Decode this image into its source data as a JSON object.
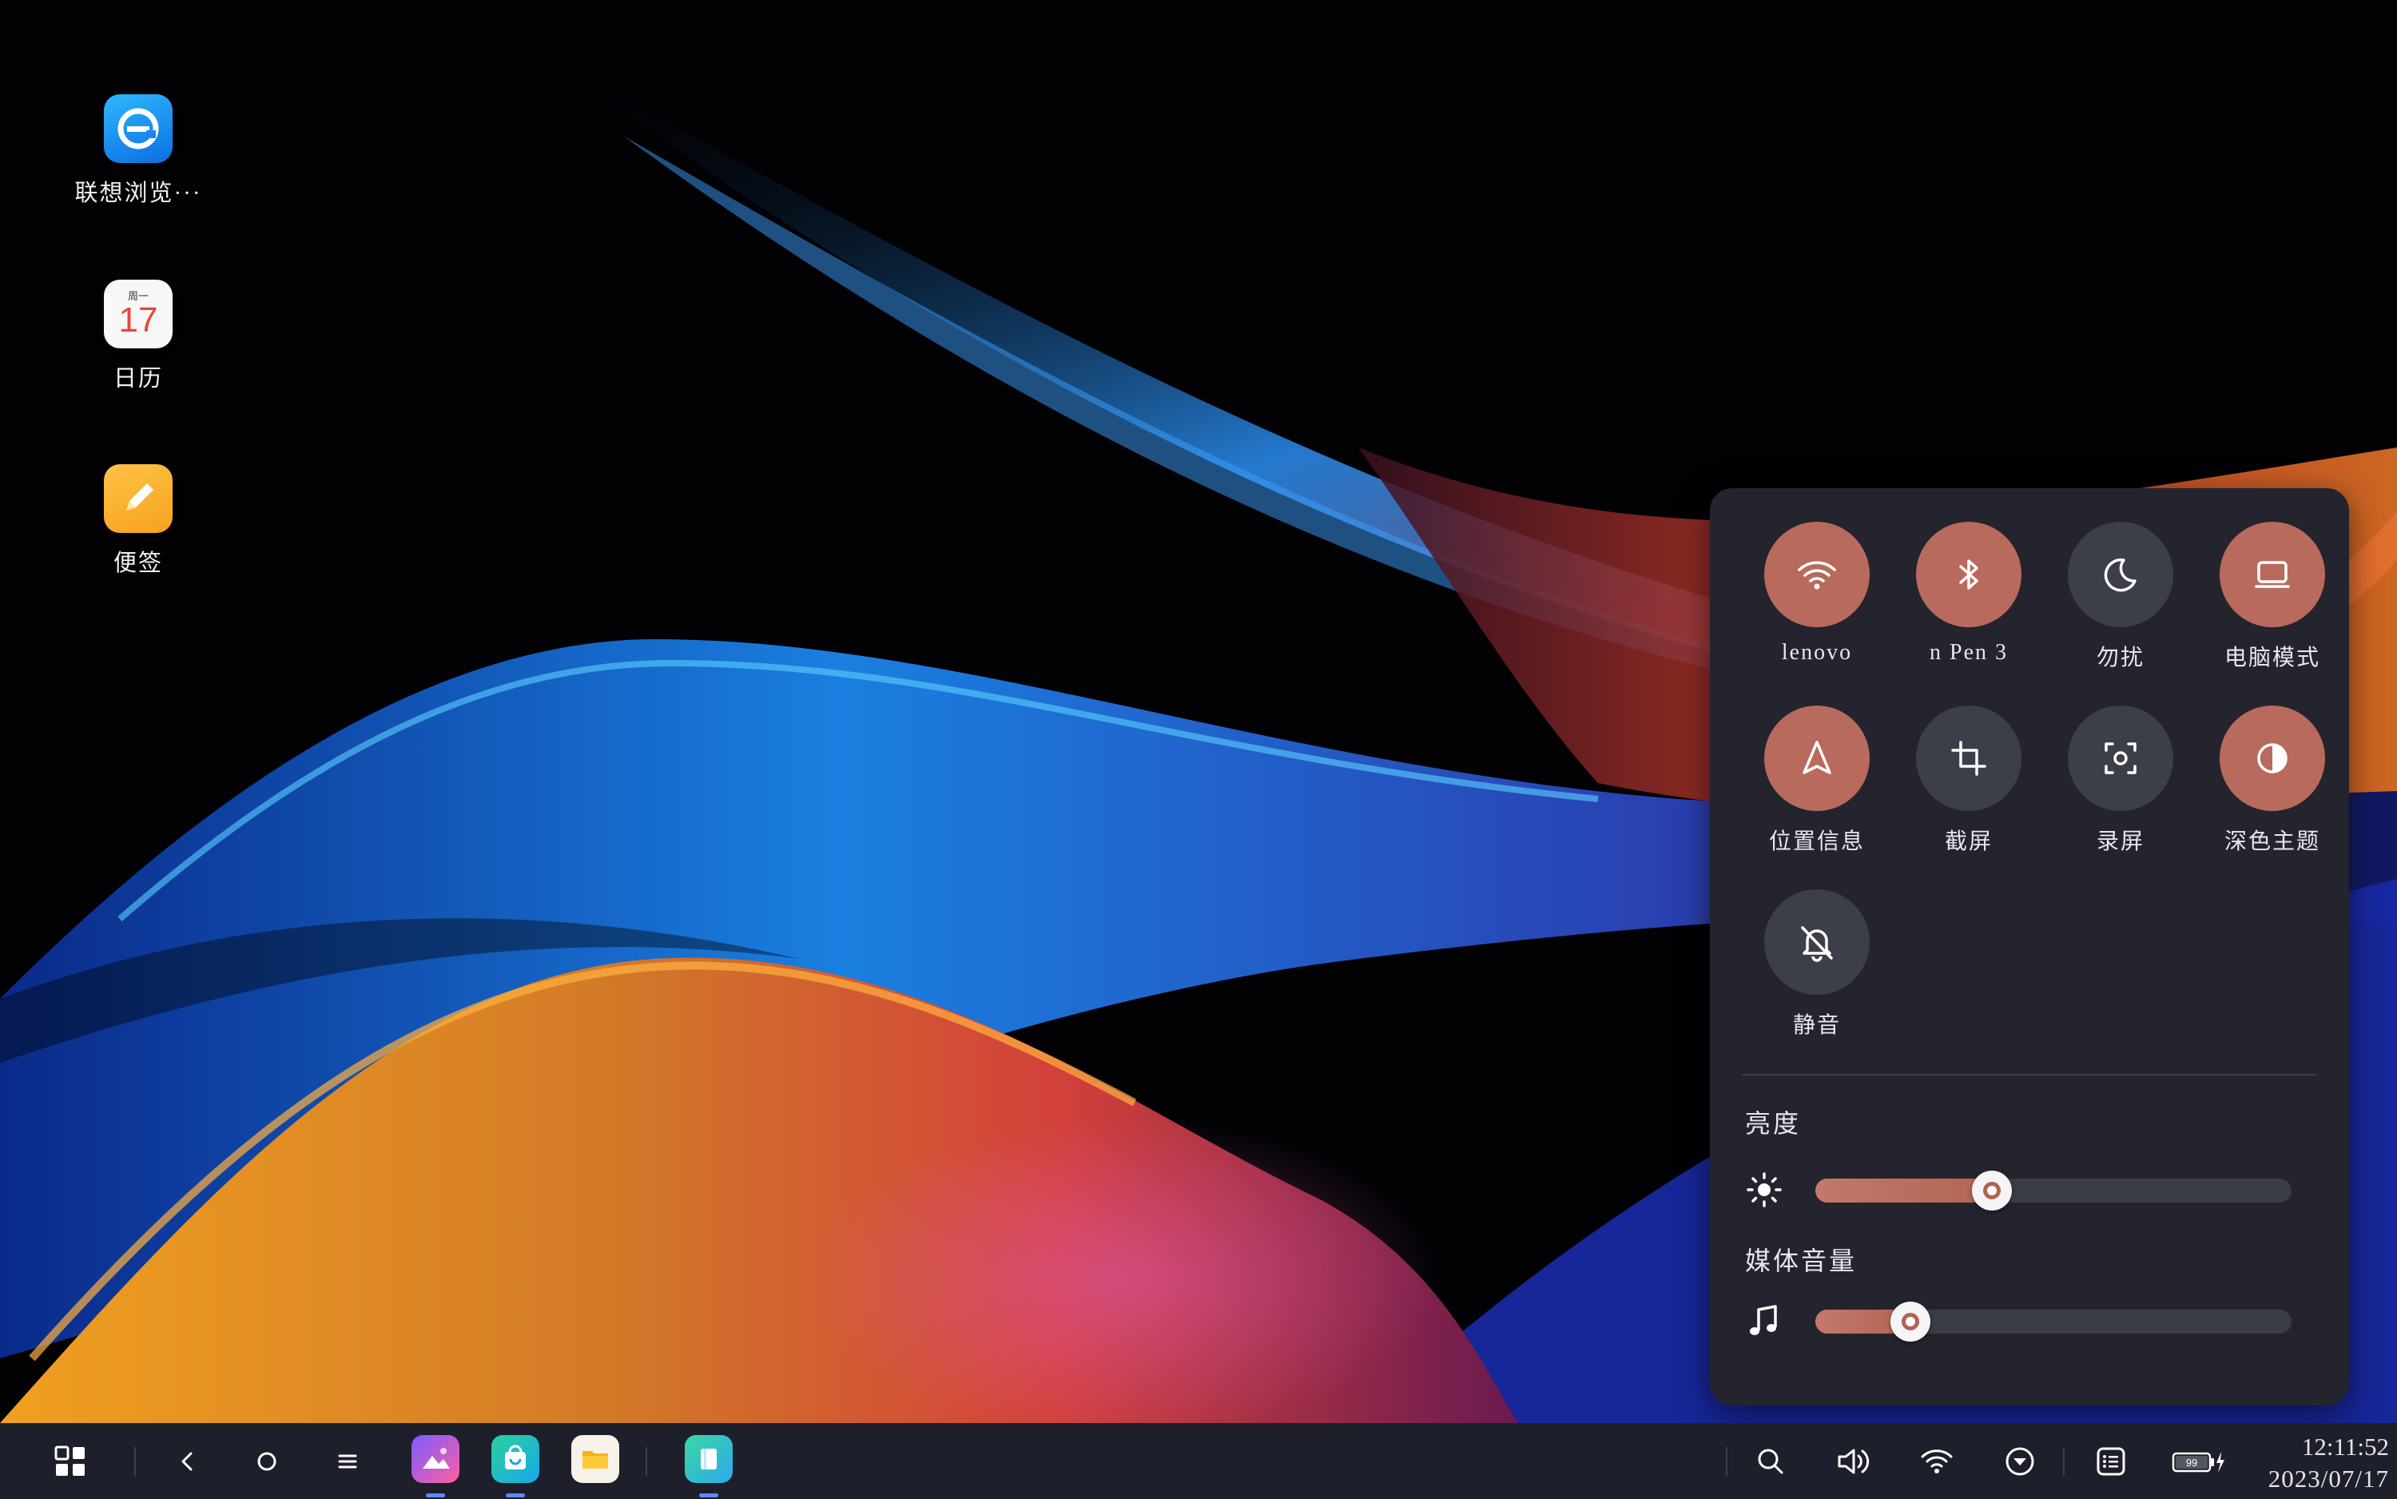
{
  "desktop": {
    "icons": [
      {
        "label": "联想浏览···",
        "icon": "lenovo-browser-icon"
      },
      {
        "label": "日历",
        "icon": "calendar-icon",
        "weekday": "周一",
        "day": "17"
      },
      {
        "label": "便签",
        "icon": "notes-icon"
      }
    ]
  },
  "control_panel": {
    "tiles": [
      {
        "label": "lenovo",
        "icon": "wifi-icon",
        "state": "on"
      },
      {
        "label": "n Pen 3",
        "icon": "bluetooth-icon",
        "state": "on"
      },
      {
        "label": "勿扰",
        "icon": "moon-icon",
        "state": "off"
      },
      {
        "label": "电脑模式",
        "icon": "laptop-icon",
        "state": "on"
      },
      {
        "label": "位置信息",
        "icon": "location-arrow-icon",
        "state": "on"
      },
      {
        "label": "截屏",
        "icon": "crop-icon",
        "state": "off"
      },
      {
        "label": "录屏",
        "icon": "screen-record-icon",
        "state": "off"
      },
      {
        "label": "深色主题",
        "icon": "dark-theme-icon",
        "state": "on"
      },
      {
        "label": "静音",
        "icon": "bell-off-icon",
        "state": "off"
      }
    ],
    "brightness": {
      "label": "亮度",
      "icon": "sun-icon",
      "value": 0.37
    },
    "media_volume": {
      "label": "媒体音量",
      "icon": "music-note-icon",
      "value": 0.2
    }
  },
  "taskbar": {
    "left_buttons": [
      "app-grid-icon",
      "back-icon",
      "home-icon",
      "menu-icon"
    ],
    "pinned_apps": [
      "gallery-app-icon",
      "app-store-icon",
      "file-manager-icon",
      "reader-app-icon"
    ],
    "tray_icons": [
      "search-icon",
      "volume-icon",
      "wifi-icon",
      "download-icon",
      "notifications-icon",
      "battery-icon"
    ],
    "battery_level": "99",
    "time": "12:11:52",
    "date": "2023/07/17"
  },
  "colors": {
    "tile_on": "#b86a5c",
    "tile_off": "#3c3e48",
    "panel_bg": "#23242e",
    "taskbar_bg": "#1d1f2b"
  }
}
